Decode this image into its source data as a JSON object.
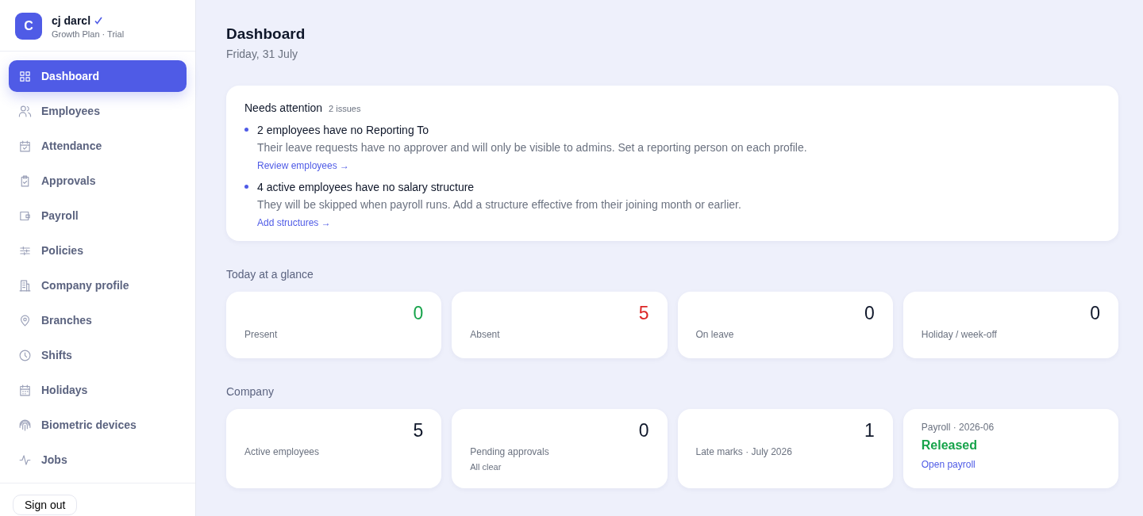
{
  "account": {
    "avatar": "C",
    "name": "cj darcl",
    "verified": true,
    "plan": "Growth Plan · Trial"
  },
  "sidebar": {
    "items": [
      {
        "label": "Dashboard",
        "kind": "grid",
        "selected": true
      },
      {
        "label": "Employees",
        "kind": "people",
        "selected": false
      },
      {
        "label": "Attendance",
        "kind": "calendar-check",
        "selected": false
      },
      {
        "label": "Approvals",
        "kind": "clipboard",
        "selected": false
      },
      {
        "label": "Payroll",
        "kind": "wallet",
        "selected": false
      },
      {
        "label": "Policies",
        "kind": "sliders",
        "selected": false
      },
      {
        "label": "Company profile",
        "kind": "building",
        "selected": false
      },
      {
        "label": "Branches",
        "kind": "pin",
        "selected": false
      },
      {
        "label": "Shifts",
        "kind": "clock",
        "selected": false
      },
      {
        "label": "Holidays",
        "kind": "calendar",
        "selected": false
      },
      {
        "label": "Biometric devices",
        "kind": "fingerprint",
        "selected": false
      },
      {
        "label": "Jobs",
        "kind": "pulse",
        "selected": false
      }
    ],
    "sign_out": "Sign out"
  },
  "page": {
    "title": "Dashboard",
    "date": "Friday, 31 July"
  },
  "attention": {
    "title": "Needs attention",
    "count": "2 issues",
    "issues": [
      {
        "title": "2 employees have no Reporting To",
        "text": "Their leave requests have no approver and will only be visible to admins. Set a reporting person on each profile.",
        "link": "Review employees →"
      },
      {
        "title": "4 active employees have no salary structure",
        "text": "They will be skipped when payroll runs. Add a structure effective from their joining month or earlier.",
        "link": "Add structures →"
      }
    ]
  },
  "sections": [
    {
      "title": "Today at a glance",
      "cards": [
        {
          "kind": "stat",
          "value": "0",
          "color": "#16a34a",
          "label": "Present"
        },
        {
          "kind": "stat",
          "value": "5",
          "color": "#dc2626",
          "label": "Absent"
        },
        {
          "kind": "stat",
          "value": "0",
          "color": "#0f172a",
          "label": "On leave"
        },
        {
          "kind": "stat",
          "value": "0",
          "color": "#0f172a",
          "label": "Holiday / week-off"
        }
      ]
    },
    {
      "title": "Company",
      "cards": [
        {
          "kind": "stat",
          "value": "5",
          "color": "#0f172a",
          "label": "Active employees"
        },
        {
          "kind": "stat",
          "value": "0",
          "color": "#0f172a",
          "label": "Pending approvals",
          "note": "All clear"
        },
        {
          "kind": "stat",
          "value": "1",
          "color": "#0f172a",
          "label": "Late marks · July 2026"
        },
        {
          "kind": "status",
          "caption": "Payroll · 2026-06",
          "status": "Released",
          "color": "#16a34a",
          "link": "Open payroll"
        }
      ]
    }
  ]
}
